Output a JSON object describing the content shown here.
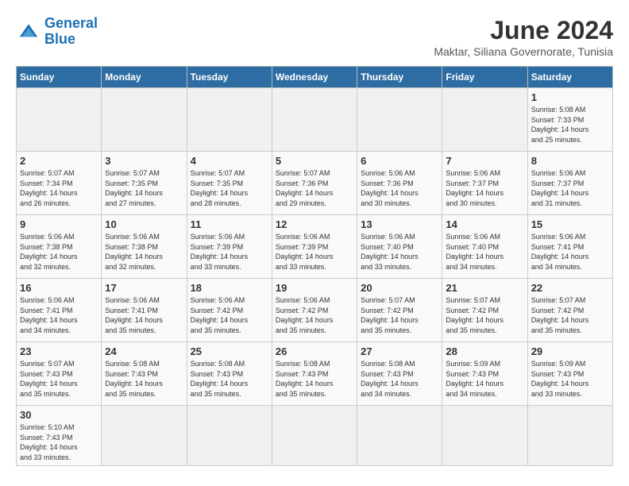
{
  "logo": {
    "line1": "General",
    "line2": "Blue"
  },
  "title": "June 2024",
  "subtitle": "Maktar, Siliana Governorate, Tunisia",
  "weekdays": [
    "Sunday",
    "Monday",
    "Tuesday",
    "Wednesday",
    "Thursday",
    "Friday",
    "Saturday"
  ],
  "weeks": [
    [
      {
        "day": "",
        "info": ""
      },
      {
        "day": "",
        "info": ""
      },
      {
        "day": "",
        "info": ""
      },
      {
        "day": "",
        "info": ""
      },
      {
        "day": "",
        "info": ""
      },
      {
        "day": "",
        "info": ""
      },
      {
        "day": "1",
        "info": "Sunrise: 5:08 AM\nSunset: 7:33 PM\nDaylight: 14 hours\nand 25 minutes."
      }
    ],
    [
      {
        "day": "2",
        "info": "Sunrise: 5:07 AM\nSunset: 7:34 PM\nDaylight: 14 hours\nand 26 minutes."
      },
      {
        "day": "3",
        "info": "Sunrise: 5:07 AM\nSunset: 7:35 PM\nDaylight: 14 hours\nand 27 minutes."
      },
      {
        "day": "4",
        "info": "Sunrise: 5:07 AM\nSunset: 7:35 PM\nDaylight: 14 hours\nand 28 minutes."
      },
      {
        "day": "5",
        "info": "Sunrise: 5:07 AM\nSunset: 7:36 PM\nDaylight: 14 hours\nand 29 minutes."
      },
      {
        "day": "6",
        "info": "Sunrise: 5:06 AM\nSunset: 7:36 PM\nDaylight: 14 hours\nand 30 minutes."
      },
      {
        "day": "7",
        "info": "Sunrise: 5:06 AM\nSunset: 7:37 PM\nDaylight: 14 hours\nand 30 minutes."
      },
      {
        "day": "8",
        "info": "Sunrise: 5:06 AM\nSunset: 7:37 PM\nDaylight: 14 hours\nand 31 minutes."
      }
    ],
    [
      {
        "day": "9",
        "info": "Sunrise: 5:06 AM\nSunset: 7:38 PM\nDaylight: 14 hours\nand 32 minutes."
      },
      {
        "day": "10",
        "info": "Sunrise: 5:06 AM\nSunset: 7:38 PM\nDaylight: 14 hours\nand 32 minutes."
      },
      {
        "day": "11",
        "info": "Sunrise: 5:06 AM\nSunset: 7:39 PM\nDaylight: 14 hours\nand 33 minutes."
      },
      {
        "day": "12",
        "info": "Sunrise: 5:06 AM\nSunset: 7:39 PM\nDaylight: 14 hours\nand 33 minutes."
      },
      {
        "day": "13",
        "info": "Sunrise: 5:06 AM\nSunset: 7:40 PM\nDaylight: 14 hours\nand 33 minutes."
      },
      {
        "day": "14",
        "info": "Sunrise: 5:06 AM\nSunset: 7:40 PM\nDaylight: 14 hours\nand 34 minutes."
      },
      {
        "day": "15",
        "info": "Sunrise: 5:06 AM\nSunset: 7:41 PM\nDaylight: 14 hours\nand 34 minutes."
      }
    ],
    [
      {
        "day": "16",
        "info": "Sunrise: 5:06 AM\nSunset: 7:41 PM\nDaylight: 14 hours\nand 34 minutes."
      },
      {
        "day": "17",
        "info": "Sunrise: 5:06 AM\nSunset: 7:41 PM\nDaylight: 14 hours\nand 35 minutes."
      },
      {
        "day": "18",
        "info": "Sunrise: 5:06 AM\nSunset: 7:42 PM\nDaylight: 14 hours\nand 35 minutes."
      },
      {
        "day": "19",
        "info": "Sunrise: 5:06 AM\nSunset: 7:42 PM\nDaylight: 14 hours\nand 35 minutes."
      },
      {
        "day": "20",
        "info": "Sunrise: 5:07 AM\nSunset: 7:42 PM\nDaylight: 14 hours\nand 35 minutes."
      },
      {
        "day": "21",
        "info": "Sunrise: 5:07 AM\nSunset: 7:42 PM\nDaylight: 14 hours\nand 35 minutes."
      },
      {
        "day": "22",
        "info": "Sunrise: 5:07 AM\nSunset: 7:42 PM\nDaylight: 14 hours\nand 35 minutes."
      }
    ],
    [
      {
        "day": "23",
        "info": "Sunrise: 5:07 AM\nSunset: 7:43 PM\nDaylight: 14 hours\nand 35 minutes."
      },
      {
        "day": "24",
        "info": "Sunrise: 5:08 AM\nSunset: 7:43 PM\nDaylight: 14 hours\nand 35 minutes."
      },
      {
        "day": "25",
        "info": "Sunrise: 5:08 AM\nSunset: 7:43 PM\nDaylight: 14 hours\nand 35 minutes."
      },
      {
        "day": "26",
        "info": "Sunrise: 5:08 AM\nSunset: 7:43 PM\nDaylight: 14 hours\nand 35 minutes."
      },
      {
        "day": "27",
        "info": "Sunrise: 5:08 AM\nSunset: 7:43 PM\nDaylight: 14 hours\nand 34 minutes."
      },
      {
        "day": "28",
        "info": "Sunrise: 5:09 AM\nSunset: 7:43 PM\nDaylight: 14 hours\nand 34 minutes."
      },
      {
        "day": "29",
        "info": "Sunrise: 5:09 AM\nSunset: 7:43 PM\nDaylight: 14 hours\nand 33 minutes."
      }
    ],
    [
      {
        "day": "30",
        "info": "Sunrise: 5:10 AM\nSunset: 7:43 PM\nDaylight: 14 hours\nand 33 minutes."
      },
      {
        "day": "",
        "info": ""
      },
      {
        "day": "",
        "info": ""
      },
      {
        "day": "",
        "info": ""
      },
      {
        "day": "",
        "info": ""
      },
      {
        "day": "",
        "info": ""
      },
      {
        "day": "",
        "info": ""
      }
    ]
  ]
}
